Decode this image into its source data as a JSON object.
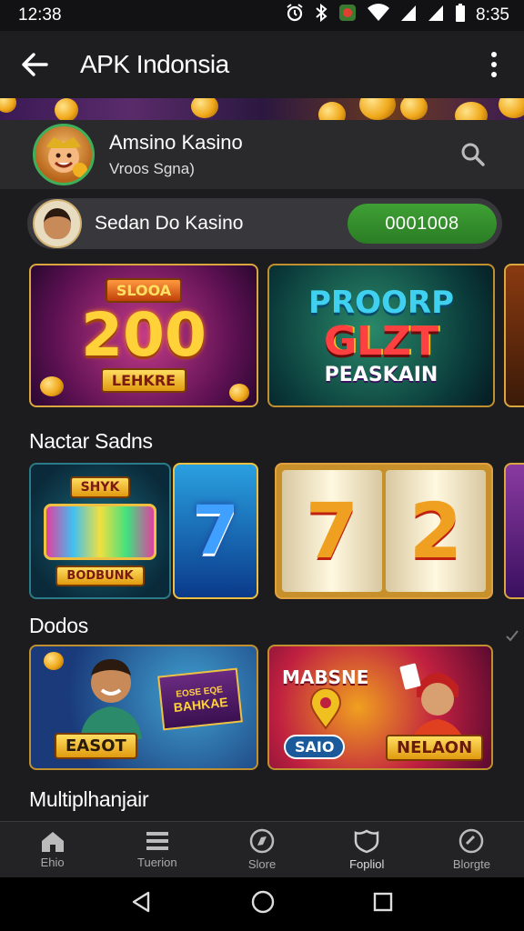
{
  "status_bar": {
    "time_left": "12:38",
    "time_right": "8:35"
  },
  "app_bar": {
    "title": "APK Indonsia"
  },
  "profile": {
    "name": "Amsino Kasino",
    "subtitle": "Vroos Sgna)"
  },
  "balance": {
    "label": "Sedan Do Kasino",
    "amount": "0001008"
  },
  "featured": [
    {
      "top_label": "SLOOA",
      "number": "200",
      "bottom_label": "LEHKRE"
    },
    {
      "line1": "PROORP",
      "line2": "GLZT",
      "bottom_label": "PEASKAIN"
    }
  ],
  "sections": [
    {
      "title": "Nactar Sadns"
    },
    {
      "title": "Dodos"
    },
    {
      "title": "Multiplhanjair"
    }
  ],
  "slot_tiles": [
    {
      "top_label": "SHYK",
      "bottom_label": "BODBUNK"
    },
    {
      "number": "7"
    },
    {
      "number_left": "7",
      "number_right": "2"
    }
  ],
  "promo_tiles": [
    {
      "top_label": "EOSE EQE",
      "mid_label": "BAHKAE",
      "bottom_label": "EASOT"
    },
    {
      "top_label": "MABSNE",
      "badge": "SAIO",
      "bottom_label": "NELAON"
    }
  ],
  "bottom_nav": [
    {
      "label": "Ehio",
      "icon": "home-icon"
    },
    {
      "label": "Tuerion",
      "icon": "list-icon"
    },
    {
      "label": "Slore",
      "icon": "compass-icon"
    },
    {
      "label": "Fopliol",
      "icon": "shield-icon"
    },
    {
      "label": "Blorgte",
      "icon": "settings-icon"
    }
  ],
  "colors": {
    "accent_green": "#3fa035",
    "gold": "#d9a640",
    "background": "#1c1c1e"
  }
}
